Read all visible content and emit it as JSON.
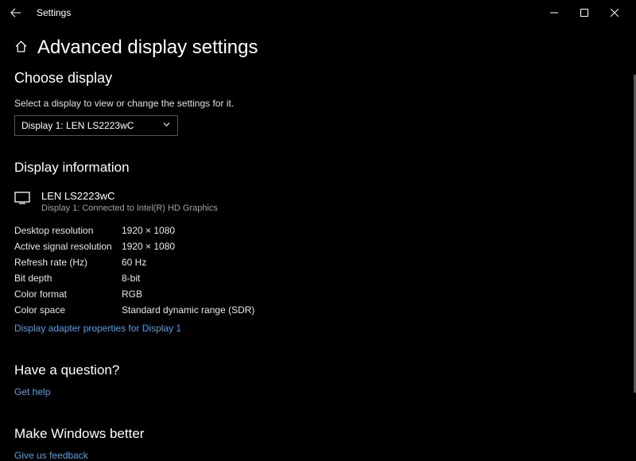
{
  "titlebar": {
    "app_title": "Settings"
  },
  "page": {
    "title": "Advanced display settings"
  },
  "choose_display": {
    "title": "Choose display",
    "subtitle": "Select a display to view or change the settings for it.",
    "selected": "Display 1: LEN LS2223wC"
  },
  "display_info": {
    "title": "Display information",
    "monitor_name": "LEN LS2223wC",
    "monitor_sub": "Display 1: Connected to Intel(R) HD Graphics",
    "rows": [
      {
        "label": "Desktop resolution",
        "value": "1920 × 1080"
      },
      {
        "label": "Active signal resolution",
        "value": "1920 × 1080"
      },
      {
        "label": "Refresh rate (Hz)",
        "value": "60 Hz"
      },
      {
        "label": "Bit depth",
        "value": "8-bit"
      },
      {
        "label": "Color format",
        "value": "RGB"
      },
      {
        "label": "Color space",
        "value": "Standard dynamic range (SDR)"
      }
    ],
    "adapter_link": "Display adapter properties for Display 1"
  },
  "question": {
    "title": "Have a question?",
    "link": "Get help"
  },
  "feedback": {
    "title": "Make Windows better",
    "link": "Give us feedback"
  }
}
